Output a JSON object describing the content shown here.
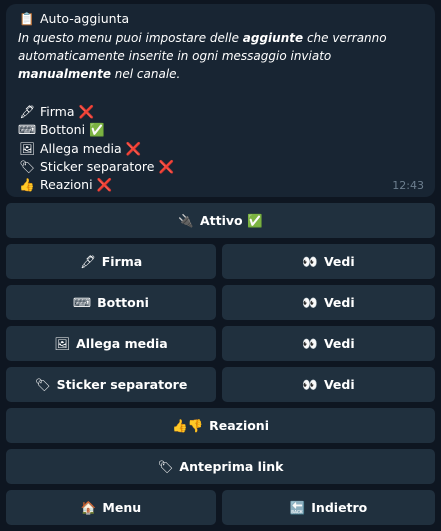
{
  "message": {
    "title_icon": "📋",
    "title": "Auto-aggiunta",
    "desc_parts": [
      "In questo menu puoi impostare delle ",
      "aggiunte",
      " che verranno automaticamente inserite in ogni messaggio inviato ",
      "manualmente",
      " nel canale."
    ],
    "items": [
      {
        "icon": "🖋",
        "label": "Firma",
        "status": "❌"
      },
      {
        "icon": "⌨",
        "label": "Bottoni",
        "status": "✅"
      },
      {
        "icon": "🖼",
        "label": "Allega media",
        "status": "❌"
      },
      {
        "icon": "🏷",
        "label": "Sticker separatore",
        "status": "❌"
      },
      {
        "icon": "👍",
        "label": "Reazioni",
        "status": "❌"
      }
    ],
    "time": "12:43"
  },
  "buttons": {
    "attivo": {
      "icon": "🔌",
      "label": "Attivo ✅"
    },
    "firma": {
      "icon": "🖋",
      "label": "Firma"
    },
    "firma_vedi": {
      "icon": "👀",
      "label": "Vedi"
    },
    "bottoni": {
      "icon": "⌨",
      "label": "Bottoni"
    },
    "bottoni_vedi": {
      "icon": "👀",
      "label": "Vedi"
    },
    "media": {
      "icon": "🖼",
      "label": "Allega media"
    },
    "media_vedi": {
      "icon": "👀",
      "label": "Vedi"
    },
    "sticker": {
      "icon": "🏷",
      "label": "Sticker separatore"
    },
    "sticker_vedi": {
      "icon": "👀",
      "label": "Vedi"
    },
    "reazioni": {
      "icon": "👍👎",
      "label": "Reazioni"
    },
    "anteprima": {
      "icon": "🏷",
      "label": "Anteprima link"
    },
    "menu": {
      "icon": "🏠",
      "label": "Menu"
    },
    "indietro": {
      "icon": "🔙",
      "label": "Indietro"
    }
  }
}
